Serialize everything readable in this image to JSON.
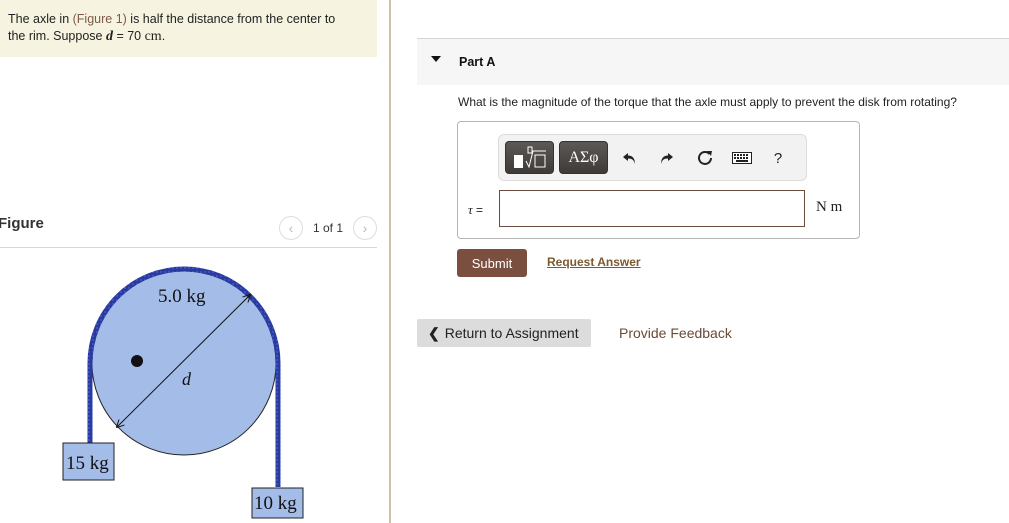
{
  "intro": {
    "text_before_link": "The axle in ",
    "link_text": "(Figure 1)",
    "text_after_link": " is half the distance from the center to",
    "line2_prefix": "the rim. Suppose ",
    "variable": "d",
    "equals": " = 70 ",
    "unit": "cm",
    "period": "."
  },
  "figure_panel": {
    "title": "Figure",
    "pager_text": "1 of 1",
    "prev_icon": "chevron-left-icon",
    "next_icon": "chevron-right-icon",
    "diagram": {
      "disk_label": "5.0 kg",
      "diameter_label": "d",
      "left_mass_label": "15 kg",
      "right_mass_label": "10 kg",
      "disk_color": "#a3bce8",
      "rope_color": "#2a3a9e"
    }
  },
  "part": {
    "title": "Part A",
    "question": "What is the magnitude of the torque that the axle must apply to prevent the disk from rotating?",
    "toolbar": {
      "templates_icon": "templates-icon",
      "greek_label": "ΑΣφ",
      "undo_icon": "undo-icon",
      "redo_icon": "redo-icon",
      "reset_icon": "reset-icon",
      "keyboard_icon": "keyboard-icon",
      "help_label": "?"
    },
    "input_label_symbol": "τ",
    "input_label_eq": " =",
    "input_value": "",
    "units": "N m",
    "submit_label": "Submit",
    "request_answer_label": "Request Answer"
  },
  "footer": {
    "return_label": "Return to Assignment",
    "feedback_label": "Provide Feedback"
  },
  "colors": {
    "accent_brown": "#7b4f3f",
    "intro_bg": "#f6f4e1",
    "divider": "#d3bfa9"
  }
}
